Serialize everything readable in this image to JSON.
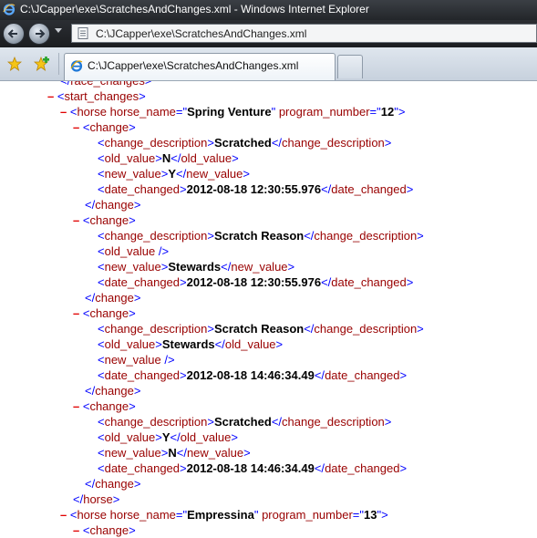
{
  "window": {
    "title": "C:\\JCapper\\exe\\ScratchesAndChanges.xml - Windows Internet Explorer"
  },
  "address_bar": {
    "url": "C:\\JCapper\\exe\\ScratchesAndChanges.xml"
  },
  "tab": {
    "label": "C:\\JCapper\\exe\\ScratchesAndChanges.xml"
  },
  "icons": {
    "back": "back-arrow-icon",
    "forward": "forward-arrow-icon",
    "favorites": "favorites-star-icon",
    "add_favorites": "add-favorites-icon",
    "page": "page-icon",
    "ie": "internet-explorer-icon"
  },
  "colors": {
    "tag": "#990000",
    "markup": "#0000ff",
    "collapse": "#e00000",
    "value": "#000000"
  },
  "xml": {
    "partial_top": "</race_changes>",
    "start_tag": "<start_changes>",
    "horses": [
      {
        "name": "Spring Venture",
        "program_number": "12",
        "changes": [
          {
            "description": "Scratched",
            "old_value": "N",
            "new_value": "Y",
            "date_changed": "2012-08-18 12:30:55.976"
          },
          {
            "description": "Scratch Reason",
            "old_value": "",
            "new_value": "Stewards",
            "date_changed": "2012-08-18 12:30:55.976"
          },
          {
            "description": "Scratch Reason",
            "old_value": "Stewards",
            "new_value": "",
            "date_changed": "2012-08-18 14:46:34.49"
          },
          {
            "description": "Scratched",
            "old_value": "Y",
            "new_value": "N",
            "date_changed": "2012-08-18 14:46:34.49"
          }
        ]
      },
      {
        "name": "Empressina",
        "program_number": "13",
        "changes": []
      }
    ]
  }
}
